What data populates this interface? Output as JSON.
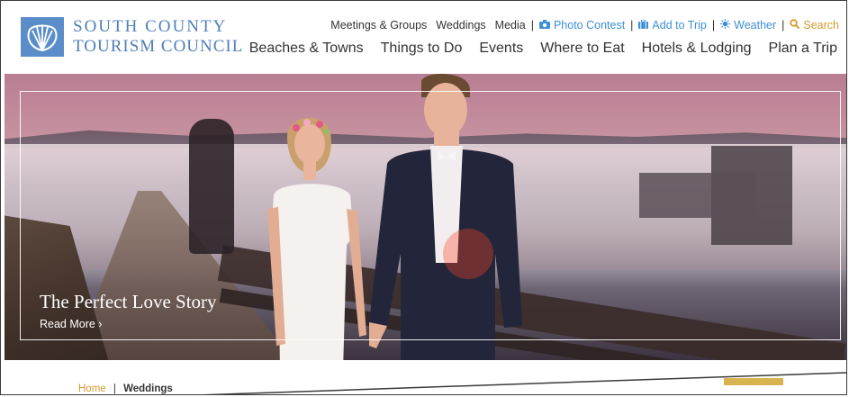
{
  "logo": {
    "line1": "SOUTH COUNTY",
    "line2": "TOURISM COUNCIL",
    "icon": "shell-icon",
    "color": "#4f7fb8"
  },
  "utility_nav": {
    "meetings": "Meetings & Groups",
    "weddings": "Weddings",
    "media": "Media",
    "photo_contest": "Photo Contest",
    "add_to_trip": "Add to Trip",
    "weather": "Weather",
    "search": "Search",
    "separator": "|"
  },
  "main_nav": {
    "items": [
      "Beaches & Towns",
      "Things to Do",
      "Events",
      "Where to Eat",
      "Hotels & Lodging",
      "Plan a Trip"
    ]
  },
  "hero": {
    "title": "The Perfect Love Story",
    "link": "Read More ›"
  },
  "breadcrumb": {
    "home": "Home",
    "separator": "|",
    "current": "Weddings"
  },
  "colors": {
    "accent_blue": "#3e8fd6",
    "accent_gold": "#d79a2d",
    "brand_blue": "#5b8ec9"
  }
}
